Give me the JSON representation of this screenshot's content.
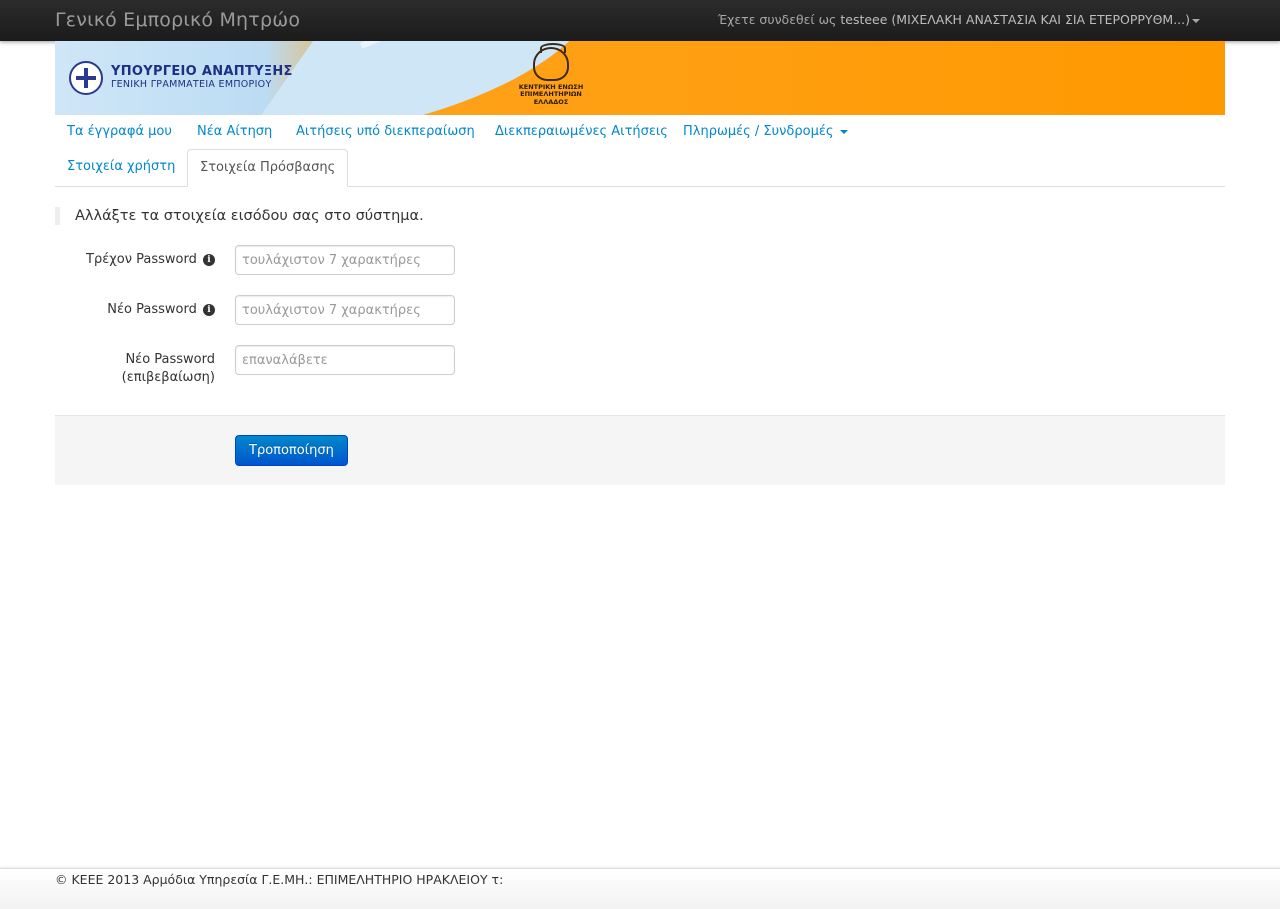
{
  "navbar": {
    "brand": "Γενικό Εμπορικό Μητρώο",
    "user_prefix": "Έχετε συνδεθεί ως",
    "user_name": "testeee (ΜΙΧΕΛΑΚΗ ΑΝΑΣΤΑΣΙΑ ΚΑΙ ΣΙΑ ΕΤΕΡΟΡΡΥΘΜ...)"
  },
  "banner": {
    "ministry_line1": "ΥΠΟΥΡΓΕΙΟ ΑΝΑΠΤΥΞΗΣ",
    "ministry_line2": "ΓΕΝΙΚΗ ΓΡΑΜΜΑΤΕΙΑ ΕΜΠΟΡΙΟΥ",
    "keee_line1": "ΚΕΝΤΡΙΚΗ ΕΝΩΣΗ",
    "keee_line2": "ΕΠΙΜΕΛΗΤΗΡΙΩΝ",
    "keee_line3": "ΕΛΛΑΔΟΣ"
  },
  "tabs": {
    "my_documents": "Τα έγγραφά μου",
    "new_application": "Νέα Αίτηση",
    "pending": "Αιτήσεις υπό διεκπεραίωση",
    "completed": "Διεκπεραιωμένες Αιτήσεις",
    "payments": "Πληρωμές / Συνδρομές",
    "user_details": "Στοιχεία χρήστη",
    "access_details": "Στοιχεία Πρόσβασης"
  },
  "form": {
    "intro": "Αλλάξτε τα στοιχεία εισόδου σας στο σύστημα.",
    "current_password_label": "Τρέχον Password",
    "current_password_placeholder": "τουλάχιστον 7 χαρακτήρες",
    "new_password_label": "Νέο Password",
    "new_password_placeholder": "τουλάχιστον 7 χαρακτήρες",
    "confirm_password_label_1": "Νέο Password",
    "confirm_password_label_2": "(επιβεβαίωση)",
    "confirm_password_placeholder": "επαναλάβετε",
    "submit_label": "Τροποποίηση"
  },
  "footer": {
    "text": "© ΚΕΕΕ 2013 Αρμόδια Υπηρεσία Γ.Ε.ΜΗ.: ΕΠΙΜΕΛΗΤΗΡΙΟ ΗΡΑΚΛΕΙΟΥ τ:"
  },
  "colors": {
    "link": "#0088cc",
    "navbar": "#1b1b1b",
    "banner_orange": "#ff9900",
    "primary_button": "#0055cc"
  }
}
